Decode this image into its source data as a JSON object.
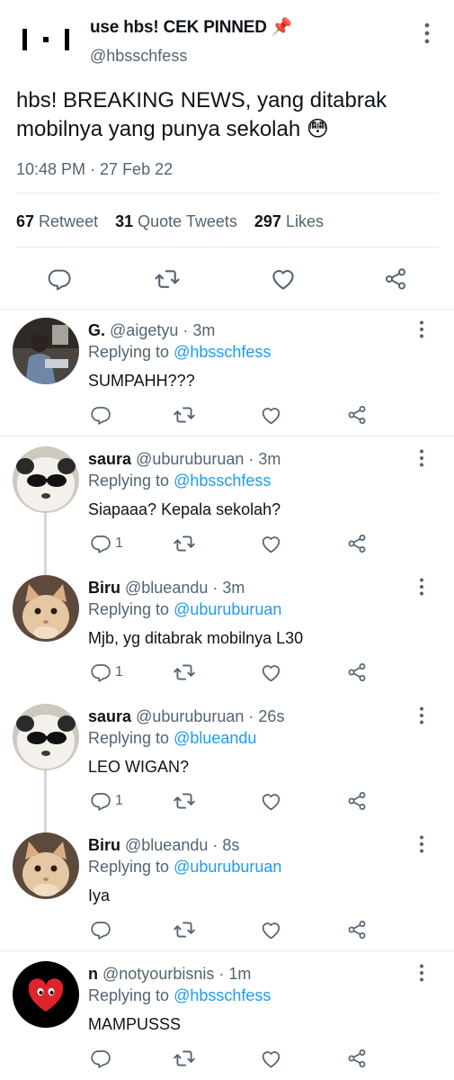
{
  "main_tweet": {
    "display_name": "use hbs! CEK PINNED 📌",
    "handle": "@hbsschfess",
    "text": "hbs! BREAKING NEWS, yang ditabrak mobilnya yang punya sekolah 😳",
    "timestamp": "10:48 PM · 27 Feb 22",
    "stats": {
      "retweets_count": "67",
      "retweets_label": "Retweet",
      "quotes_count": "31",
      "quotes_label": "Quote Tweets",
      "likes_count": "297",
      "likes_label": "Likes"
    }
  },
  "replies": [
    {
      "name": "G.",
      "handle_time": "@aigetyu · 3m",
      "replying_label": "Replying to",
      "replying_to": "@hbsschfess",
      "text": "SUMPAHH???",
      "reply_count": "",
      "avatar": "photo-person"
    },
    {
      "name": "saura",
      "handle_time": "@uburuburuan · 3m",
      "replying_label": "Replying to",
      "replying_to": "@hbsschfess",
      "text": "Siapaaa? Kepala sekolah?",
      "reply_count": "1",
      "avatar": "plush-sunglasses"
    },
    {
      "name": "Biru",
      "handle_time": "@blueandu · 3m",
      "replying_label": "Replying to",
      "replying_to": "@uburuburuan",
      "text": "Mjb, yg ditabrak mobilnya L30",
      "reply_count": "1",
      "avatar": "kitten"
    },
    {
      "name": "saura",
      "handle_time": "@uburuburuan · 26s",
      "replying_label": "Replying to",
      "replying_to": "@blueandu",
      "text": "LEO WIGAN?",
      "reply_count": "1",
      "avatar": "plush-sunglasses"
    },
    {
      "name": "Biru",
      "handle_time": "@blueandu · 8s",
      "replying_label": "Replying to",
      "replying_to": "@uburuburuan",
      "text": "Iya",
      "reply_count": "",
      "avatar": "kitten"
    },
    {
      "name": "n",
      "handle_time": "@notyourbisnis · 1m",
      "replying_label": "Replying to",
      "replying_to": "@hbsschfess",
      "text": "MAMPUSSS",
      "reply_count": "",
      "avatar": "red-heart-eyes"
    }
  ],
  "icons": [
    "more-vertical-icon",
    "reply-icon",
    "retweet-icon",
    "like-icon",
    "share-icon"
  ],
  "colors": {
    "link": "#1d9bf0",
    "secondary_text": "#536471",
    "thread_line": "#cfd9de"
  }
}
